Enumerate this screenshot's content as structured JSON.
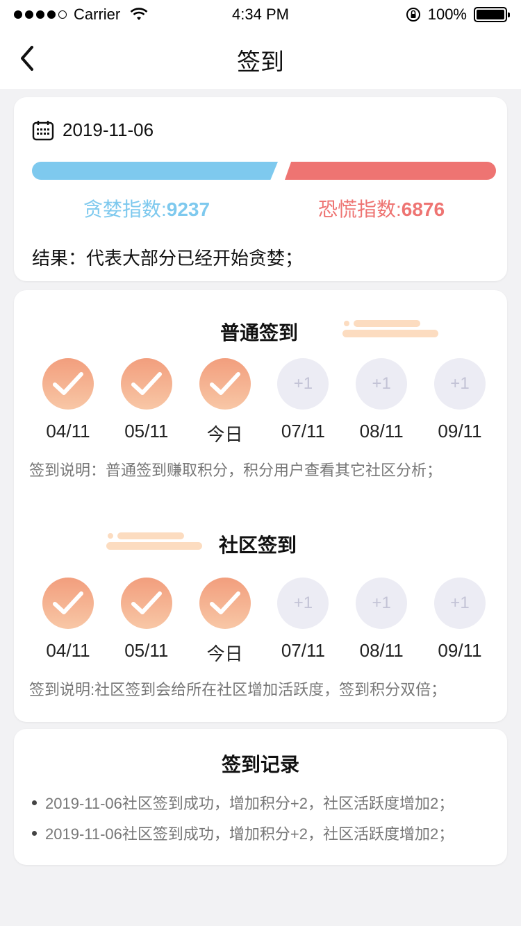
{
  "status_bar": {
    "carrier": "Carrier",
    "time": "4:34 PM",
    "battery": "100%"
  },
  "nav": {
    "title": "签到"
  },
  "summary": {
    "date": "2019-11-06",
    "greed_label": "贪婪指数:",
    "greed_value": "9237",
    "fear_label": "恐慌指数:",
    "fear_value": "6876",
    "result": "结果：代表大部分已经开始贪婪；",
    "colors": {
      "greed": "#7ec9ee",
      "fear": "#ee7472"
    }
  },
  "normal_signin": {
    "title": "普通签到",
    "days": [
      {
        "label": "04/11",
        "state": "done"
      },
      {
        "label": "05/11",
        "state": "done"
      },
      {
        "label": "今日",
        "state": "done"
      },
      {
        "label": "07/11",
        "state": "todo",
        "reward": "+1"
      },
      {
        "label": "08/11",
        "state": "todo",
        "reward": "+1"
      },
      {
        "label": "09/11",
        "state": "todo",
        "reward": "+1"
      }
    ],
    "note": "签到说明：普通签到赚取积分，积分用户查看其它社区分析；"
  },
  "community_signin": {
    "title": "社区签到",
    "days": [
      {
        "label": "04/11",
        "state": "done"
      },
      {
        "label": "05/11",
        "state": "done"
      },
      {
        "label": "今日",
        "state": "done"
      },
      {
        "label": "07/11",
        "state": "todo",
        "reward": "+1"
      },
      {
        "label": "08/11",
        "state": "todo",
        "reward": "+1"
      },
      {
        "label": "09/11",
        "state": "todo",
        "reward": "+1"
      }
    ],
    "note": "签到说明:社区签到会给所在社区增加活跃度，签到积分双倍；"
  },
  "records": {
    "title": "签到记录",
    "items": [
      "2019-11-06社区签到成功，增加积分+2，社区活跃度增加2；",
      "2019-11-06社区签到成功，增加积分+2，社区活跃度增加2；"
    ]
  }
}
